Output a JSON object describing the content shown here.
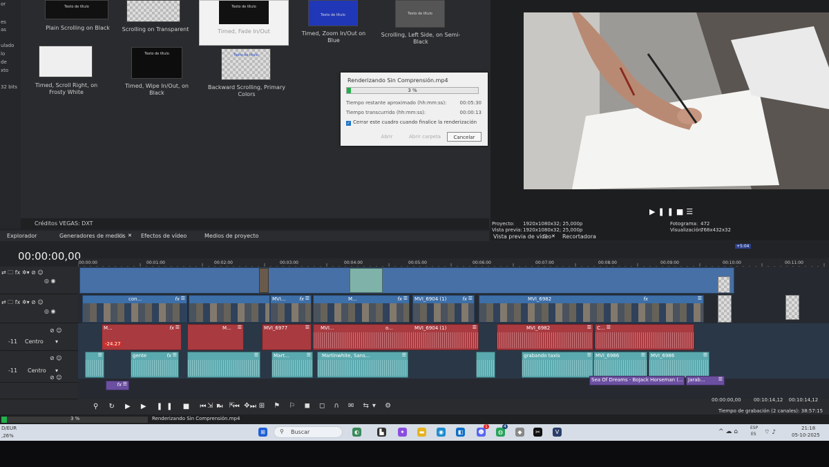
{
  "left_strip": [
    "or",
    "es",
    "as",
    "ulado",
    "lo",
    "de",
    "xto",
    "32 bits"
  ],
  "generators": [
    {
      "label": "Plain Scrolling on Black"
    },
    {
      "label": "Scrolling on Transparent"
    },
    {
      "label": "Timed, Fade In/Out"
    },
    {
      "label": "Timed, Zoom In/Out on Blue"
    },
    {
      "label": "Scrolling, Left Side, on Semi-Black"
    },
    {
      "label": "Timed, Scroll Right, on Frosty White"
    },
    {
      "label": "Timed, Wipe In/Out, on Black"
    },
    {
      "label": "Backward Scrolling, Primary Colors"
    }
  ],
  "thumb_title": "Texto de título",
  "credits_label": "Créditos VEGAS: DXT",
  "tabs": [
    "Explorador",
    "Generadores de medios",
    "Efectos de vídeo",
    "Medios de proyecto"
  ],
  "dialog": {
    "title": "Renderizando Sin Comprensión.mp4",
    "progress_text": "3 %",
    "progress": 0.03,
    "remaining_label": "Tiempo restante aproximado (hh:mm:ss):",
    "remaining_value": "00:05:30",
    "elapsed_label": "Tiempo transcurrido (hh:mm:ss):",
    "elapsed_value": "00:00:13",
    "checkbox_label": "Cerrar este cuadro cuando finalice la renderización",
    "btn_open": "Abrir",
    "btn_open_folder": "Abrir carpeta",
    "btn_cancel": "Cancelar"
  },
  "preview": {
    "project_label": "Proyecto:",
    "project_value": "1920x1080x32; 25,000p",
    "preview_label": "Vista previa:",
    "preview_value": "1920x1080x32; 25,000p",
    "frame_label": "Fotograma:",
    "frame_value": "472",
    "display_label": "Visualización:",
    "display_value": "768x432x32",
    "tab_preview": "Vista previa de vídeo",
    "tab_trimmer": "Recortadora"
  },
  "timeline": {
    "timecode": "00:00:00,00",
    "ruler": [
      "00:00:00",
      "00:01:00",
      "00:02:00",
      "00:03:00",
      "00:04:00",
      "00:05:00",
      "00:06:00",
      "00:07:00",
      "00:08:00",
      "00:09:00",
      "00:10:00",
      "00:11:00"
    ],
    "marker": "+5:04",
    "track_center": "Centro",
    "track_num": "-11",
    "db_scale": [
      "12",
      "24",
      "36",
      "48"
    ],
    "volume_value": "-24.27",
    "video_clips": [
      "con...",
      "MVI...",
      "M...",
      "MVI_6904 (1)",
      "MVI_6982"
    ],
    "red_clips": [
      "M...",
      "MVI_6977",
      "M...",
      "MVI...",
      "o...",
      "MVI_6904 (1)",
      "MVI_6982",
      "C..."
    ],
    "cyan_clips": [
      "gente",
      "Mart...",
      "Martinwhite, Sans...",
      "grabando taxis",
      "MVI_6986",
      "MVI_6986"
    ],
    "music_clip": "Sea Of Dreams - BoJack Horseman (...",
    "music_clip2": "Jarab...",
    "time_start": "00:00:00,00",
    "time_end": "00:10:14,12",
    "time_length": "00:10:14,12",
    "rec_time": "Tiempo de grabación (2 canales): 38:57:15"
  },
  "status": {
    "progress_text": "3 %",
    "progress": 0.03,
    "file": "Renderizando Sin Comprensión.mp4",
    "left1": "D/EUR",
    "left2": ",26%"
  },
  "taskbar": {
    "search_placeholder": "Buscar",
    "lang1": "ESP",
    "lang2": "ES",
    "time": "21:18",
    "date": "05-10-2025",
    "badge1": "1",
    "badge2": "4"
  },
  "colors": {
    "video_track": "#3d6fa8",
    "audio_red": "#a83a40",
    "audio_cyan": "#5aa9ae",
    "music_purple": "#6b4fa0",
    "progress_green": "#21b04b"
  }
}
